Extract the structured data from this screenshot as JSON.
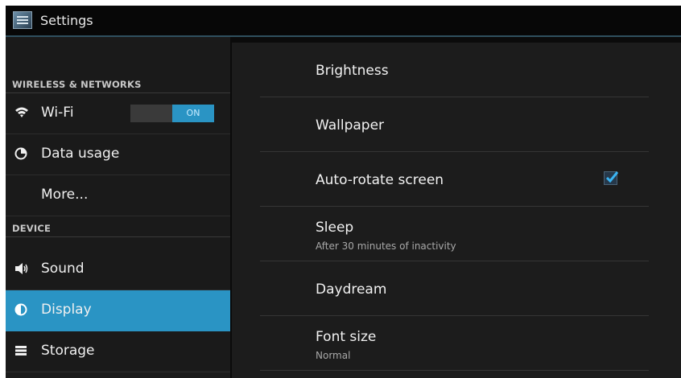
{
  "actionbar": {
    "title": "Settings",
    "icon": "settings-app-icon"
  },
  "sidebar": {
    "wireless_header": "WIRELESS & NETWORKS",
    "device_header": "DEVICE",
    "items": [
      {
        "label": "Wi-Fi",
        "icon": "wifi-icon",
        "toggle": "ON"
      },
      {
        "label": "Data usage",
        "icon": "data-usage-icon"
      },
      {
        "label": "More..."
      },
      {
        "label": "Sound",
        "icon": "sound-icon"
      },
      {
        "label": "Display",
        "icon": "display-icon",
        "active": true
      },
      {
        "label": "Storage",
        "icon": "storage-icon"
      }
    ]
  },
  "display_settings": [
    {
      "title": "Brightness"
    },
    {
      "title": "Wallpaper"
    },
    {
      "title": "Auto-rotate screen",
      "checked": true
    },
    {
      "title": "Sleep",
      "summary": "After 30 minutes of inactivity"
    },
    {
      "title": "Daydream"
    },
    {
      "title": "Font size",
      "summary": "Normal"
    }
  ],
  "colors": {
    "accent": "#2a94c4",
    "background": "#1c1c1c",
    "sidebar": "#1a1a1a"
  }
}
